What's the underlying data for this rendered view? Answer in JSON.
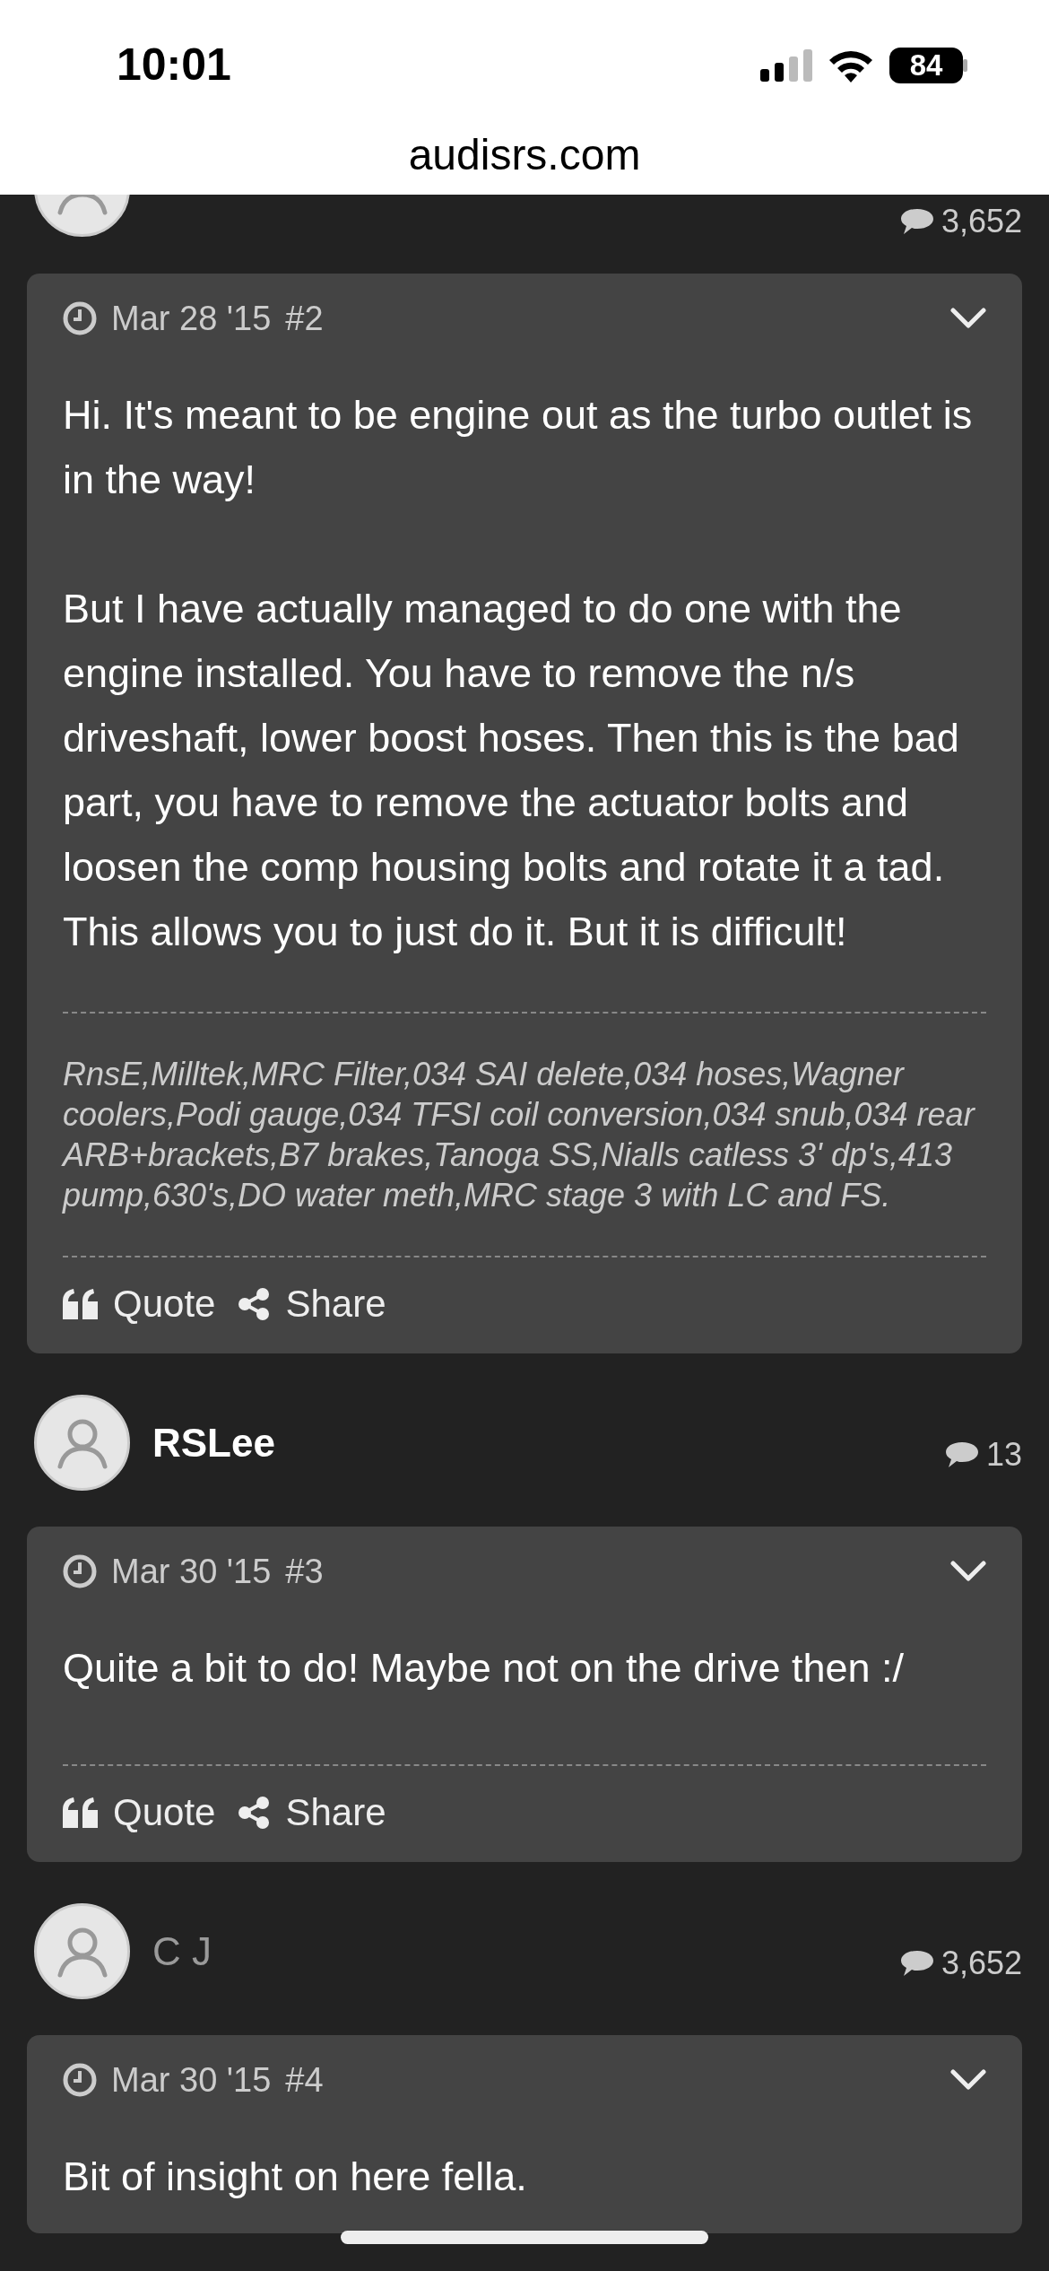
{
  "status_bar": {
    "time": "10:01",
    "battery": "84"
  },
  "address_bar": {
    "url": "audisrs.com"
  },
  "thread": [
    {
      "kind": "user",
      "clipped": true,
      "post_count": "3,652"
    },
    {
      "kind": "post",
      "date": "Mar 28 '15",
      "number": "#2",
      "paragraphs": [
        "Hi. It's meant to be engine out as the turbo outlet is in the way!",
        "But I have actually managed to do one with the engine installed. You have to remove the n/s driveshaft, lower boost hoses. Then this is the bad part, you have to remove the actuator bolts and loosen the comp housing bolts and rotate it a tad. This allows you to just do it. But it is difficult!"
      ],
      "signature": "RnsE,Milltek,MRC Filter,034 SAI delete,034 hoses,Wagner coolers,Podi gauge,034 TFSI coil conversion,034 snub,034 rear ARB+brackets,B7 brakes,Tanoga SS,Nialls catless 3' dp's,413 pump,630's,DO water meth,MRC stage 3 with LC and FS.",
      "actions": [
        {
          "kind": "quote",
          "label": "Quote"
        },
        {
          "kind": "share",
          "label": "Share"
        }
      ]
    },
    {
      "kind": "user",
      "clipped": false,
      "name": "RSLee",
      "muted": false,
      "post_count": "13"
    },
    {
      "kind": "post",
      "date": "Mar 30 '15",
      "number": "#3",
      "paragraphs": [
        "Quite a bit to do! Maybe not on the drive then :/"
      ],
      "actions": [
        {
          "kind": "quote",
          "label": "Quote"
        },
        {
          "kind": "share",
          "label": "Share"
        }
      ]
    },
    {
      "kind": "user",
      "clipped": false,
      "name": "C J",
      "muted": true,
      "post_count": "3,652"
    },
    {
      "kind": "post",
      "date": "Mar 30 '15",
      "number": "#4",
      "paragraphs": [
        "Bit of insight on here fella."
      ]
    }
  ]
}
